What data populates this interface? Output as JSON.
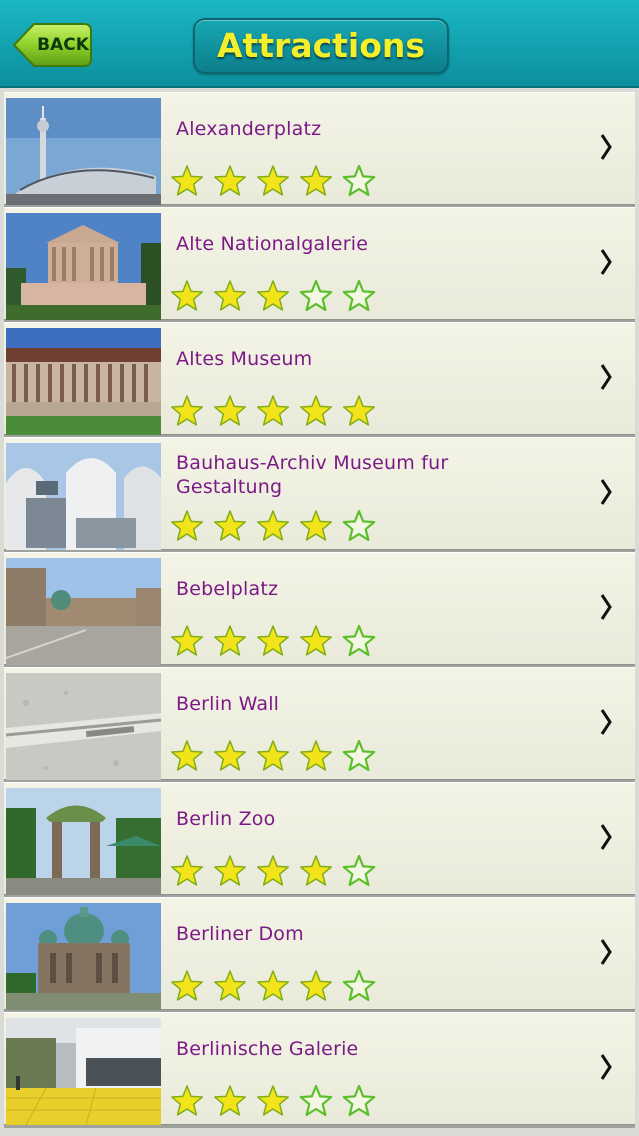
{
  "navbar": {
    "back_label": "BACK",
    "title": "Attractions"
  },
  "attractions": [
    {
      "name": "Alexanderplatz",
      "rating": 4,
      "max_rating": 5
    },
    {
      "name": "Alte Nationalgalerie",
      "rating": 3,
      "max_rating": 5
    },
    {
      "name": "Altes Museum",
      "rating": 5,
      "max_rating": 5
    },
    {
      "name": "Bauhaus-Archiv Museum fur Gestaltung",
      "rating": 4,
      "max_rating": 5
    },
    {
      "name": "Bebelplatz",
      "rating": 4,
      "max_rating": 5
    },
    {
      "name": "Berlin Wall",
      "rating": 4,
      "max_rating": 5
    },
    {
      "name": "Berlin Zoo",
      "rating": 4,
      "max_rating": 5
    },
    {
      "name": "Berliner Dom",
      "rating": 4,
      "max_rating": 5
    },
    {
      "name": "Berlinische Galerie",
      "rating": 3,
      "max_rating": 5
    }
  ],
  "icons": {
    "back": "back-arrow-icon",
    "disclosure": "chevron-right-icon",
    "star_filled": "star-filled-icon",
    "star_empty": "star-outline-icon"
  },
  "colors": {
    "navbar": "#14a5b3",
    "title": "#f4ef2a",
    "back_button": "#8ed12a",
    "item_text": "#7b1a86",
    "star_fill": "#f2e31a",
    "star_outline": "#5bbf2a"
  }
}
